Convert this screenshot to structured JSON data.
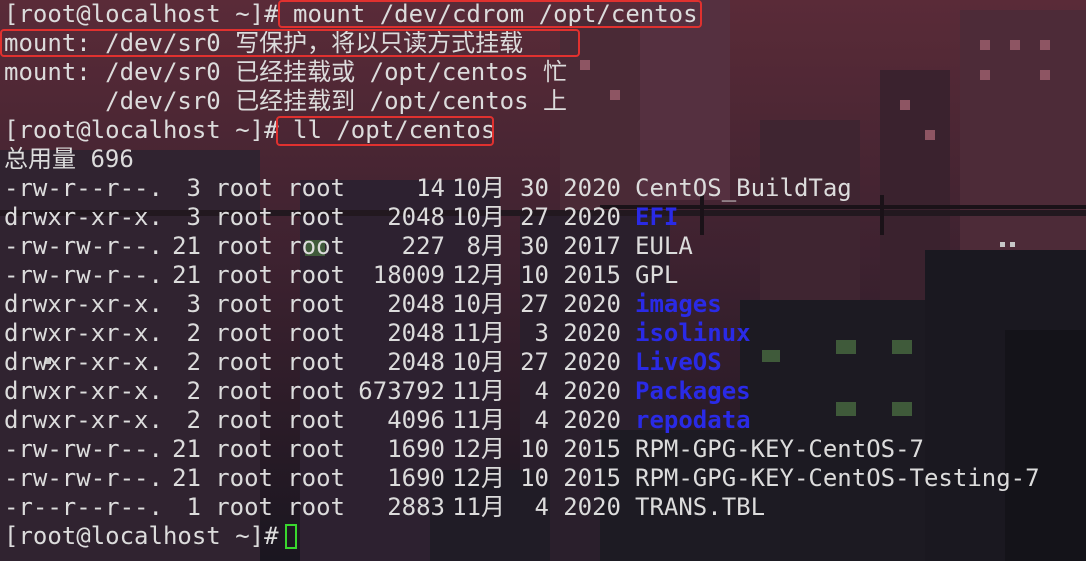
{
  "terminal": {
    "prompt": "[root@localhost ~]#",
    "cmd1": "mount /dev/cdrom /opt/centos",
    "out1": "mount: /dev/sr0 写保护，将以只读方式挂载",
    "out2": "mount: /dev/sr0 已经挂载或 /opt/centos 忙",
    "out3": "       /dev/sr0 已经挂载到 /opt/centos 上",
    "cmd2": "ll /opt/centos",
    "total": "总用量 696",
    "listing": [
      {
        "perm": "-rw-r--r--.",
        "links": "3",
        "owner": "root",
        "group": "root",
        "size": "14",
        "month": "10月",
        "day": "30",
        "year": "2020",
        "name": "CentOS_BuildTag",
        "type": "file"
      },
      {
        "perm": "drwxr-xr-x.",
        "links": "3",
        "owner": "root",
        "group": "root",
        "size": "2048",
        "month": "10月",
        "day": "27",
        "year": "2020",
        "name": "EFI",
        "type": "dir"
      },
      {
        "perm": "-rw-rw-r--.",
        "links": "21",
        "owner": "root",
        "group": "root",
        "size": "227",
        "month": "8月",
        "day": "30",
        "year": "2017",
        "name": "EULA",
        "type": "file"
      },
      {
        "perm": "-rw-rw-r--.",
        "links": "21",
        "owner": "root",
        "group": "root",
        "size": "18009",
        "month": "12月",
        "day": "10",
        "year": "2015",
        "name": "GPL",
        "type": "file"
      },
      {
        "perm": "drwxr-xr-x.",
        "links": "3",
        "owner": "root",
        "group": "root",
        "size": "2048",
        "month": "10月",
        "day": "27",
        "year": "2020",
        "name": "images",
        "type": "dir"
      },
      {
        "perm": "drwxr-xr-x.",
        "links": "2",
        "owner": "root",
        "group": "root",
        "size": "2048",
        "month": "11月",
        "day": "3",
        "year": "2020",
        "name": "isolinux",
        "type": "dir"
      },
      {
        "perm": "drwxr-xr-x.",
        "links": "2",
        "owner": "root",
        "group": "root",
        "size": "2048",
        "month": "10月",
        "day": "27",
        "year": "2020",
        "name": "LiveOS",
        "type": "dir"
      },
      {
        "perm": "drwxr-xr-x.",
        "links": "2",
        "owner": "root",
        "group": "root",
        "size": "673792",
        "month": "11月",
        "day": "4",
        "year": "2020",
        "name": "Packages",
        "type": "dir"
      },
      {
        "perm": "drwxr-xr-x.",
        "links": "2",
        "owner": "root",
        "group": "root",
        "size": "4096",
        "month": "11月",
        "day": "4",
        "year": "2020",
        "name": "repodata",
        "type": "dir"
      },
      {
        "perm": "-rw-rw-r--.",
        "links": "21",
        "owner": "root",
        "group": "root",
        "size": "1690",
        "month": "12月",
        "day": "10",
        "year": "2015",
        "name": "RPM-GPG-KEY-CentOS-7",
        "type": "file"
      },
      {
        "perm": "-rw-rw-r--.",
        "links": "21",
        "owner": "root",
        "group": "root",
        "size": "1690",
        "month": "12月",
        "day": "10",
        "year": "2015",
        "name": "RPM-GPG-KEY-CentOS-Testing-7",
        "type": "file"
      },
      {
        "perm": "-r--r--r--.",
        "links": "1",
        "owner": "root",
        "group": "root",
        "size": "2883",
        "month": "11月",
        "day": "4",
        "year": "2020",
        "name": "TRANS.TBL",
        "type": "file"
      }
    ]
  },
  "colors": {
    "text": "#dcdcdc",
    "directory": "#2a2ae6",
    "highlight_box": "#e0312f",
    "cursor": "#39d62e"
  }
}
